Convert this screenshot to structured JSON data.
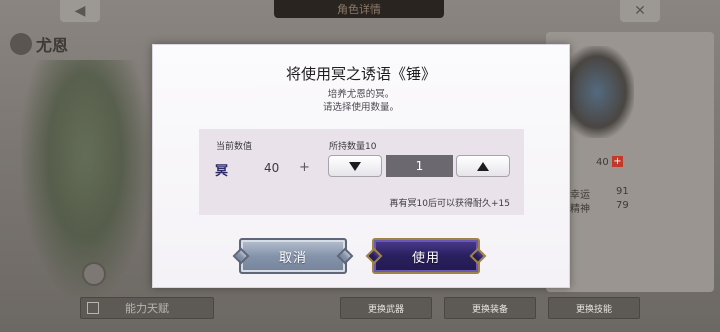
{
  "background": {
    "screen_title": "角色详情",
    "back_icon": "arrow-left-icon",
    "close_icon": "close-icon",
    "hero_name": "尤恩",
    "stats": [
      {
        "label": "幸运",
        "value": "91"
      },
      {
        "label": "精神",
        "value": "79"
      }
    ],
    "stat_top_value": "40",
    "bottom_buttons": [
      "能力天赋",
      "更换武器",
      "更换装备",
      "更换技能"
    ]
  },
  "dialog": {
    "title": "将使用冥之诱语《锤》",
    "description_line1": "培养尤恩的冥。",
    "description_line2": "请选择使用数量。",
    "current_value_label": "当前数值",
    "owned_count_label": "所持数量10",
    "item_name": "冥",
    "current_value": "40",
    "plus_sign": "+",
    "quantity": "1",
    "hint": "再有冥10后可以获得耐久+15",
    "cancel_label": "取消",
    "use_label": "使用"
  },
  "colors": {
    "dialog_bg": "#f7f5f8",
    "panel_bg": "#e9e2ea",
    "use_button": "#2a1f5e",
    "cancel_button": "#8594ab"
  }
}
